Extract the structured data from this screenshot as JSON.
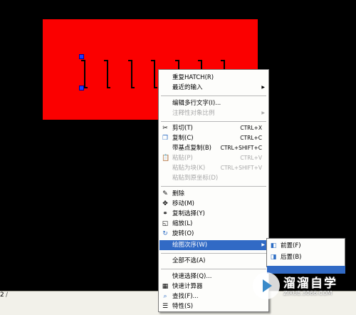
{
  "menu": {
    "items": [
      {
        "label": "重复HATCH(R)",
        "shortcut": "",
        "icon": "",
        "disabled": false
      },
      {
        "label": "最近的输入",
        "shortcut": "",
        "icon": "",
        "disabled": false,
        "submenu": true
      },
      {
        "label": "编辑多行文字(I)...",
        "shortcut": "",
        "icon": "",
        "disabled": false
      },
      {
        "label": "注释性对象比例",
        "shortcut": "",
        "icon": "",
        "disabled": true,
        "submenu": true
      },
      {
        "label": "剪切(T)",
        "shortcut": "CTRL+X",
        "icon": "scissors-icon",
        "disabled": false
      },
      {
        "label": "复制(C)",
        "shortcut": "CTRL+C",
        "icon": "copy-icon",
        "disabled": false
      },
      {
        "label": "带基点复制(B)",
        "shortcut": "CTRL+SHIFT+C",
        "icon": "",
        "disabled": false
      },
      {
        "label": "粘贴(P)",
        "shortcut": "CTRL+V",
        "icon": "paste-icon",
        "disabled": true
      },
      {
        "label": "粘贴为块(K)",
        "shortcut": "CTRL+SHIFT+V",
        "icon": "",
        "disabled": true
      },
      {
        "label": "粘贴到原坐标(D)",
        "shortcut": "",
        "icon": "",
        "disabled": true
      },
      {
        "label": "删除",
        "shortcut": "",
        "icon": "eraser-icon",
        "disabled": false
      },
      {
        "label": "移动(M)",
        "shortcut": "",
        "icon": "move-icon",
        "disabled": false
      },
      {
        "label": "复制选择(Y)",
        "shortcut": "",
        "icon": "copy-select-icon",
        "disabled": false
      },
      {
        "label": "缩放(L)",
        "shortcut": "",
        "icon": "scale-icon",
        "disabled": false
      },
      {
        "label": "旋转(O)",
        "shortcut": "",
        "icon": "rotate-icon",
        "disabled": false
      },
      {
        "label": "绘图次序(W)",
        "shortcut": "",
        "icon": "",
        "disabled": false,
        "submenu": true,
        "highlighted": true
      },
      {
        "label": "全部不选(A)",
        "shortcut": "",
        "icon": "",
        "disabled": false
      },
      {
        "label": "快速选择(Q)...",
        "shortcut": "",
        "icon": "",
        "disabled": false
      },
      {
        "label": "快速计算器",
        "shortcut": "",
        "icon": "calculator-icon",
        "disabled": false
      },
      {
        "label": "查找(F)...",
        "shortcut": "",
        "icon": "find-icon",
        "disabled": false
      },
      {
        "label": "特性(S)",
        "shortcut": "",
        "icon": "properties-icon",
        "disabled": false
      }
    ]
  },
  "submenu": {
    "items": [
      {
        "label": "前置(F)",
        "icon": "bring-front-icon"
      },
      {
        "label": "后置(B)",
        "icon": "send-back-icon"
      }
    ]
  },
  "status": {
    "command_line": "2",
    "slash": "/"
  },
  "watermark": {
    "title": "溜溜自学",
    "url": "ZIXUE.3066.COM"
  },
  "colors": {
    "hatch_fill": "#fb0000",
    "menu_highlight": "#316ac5",
    "grip": "#1a3cff"
  }
}
